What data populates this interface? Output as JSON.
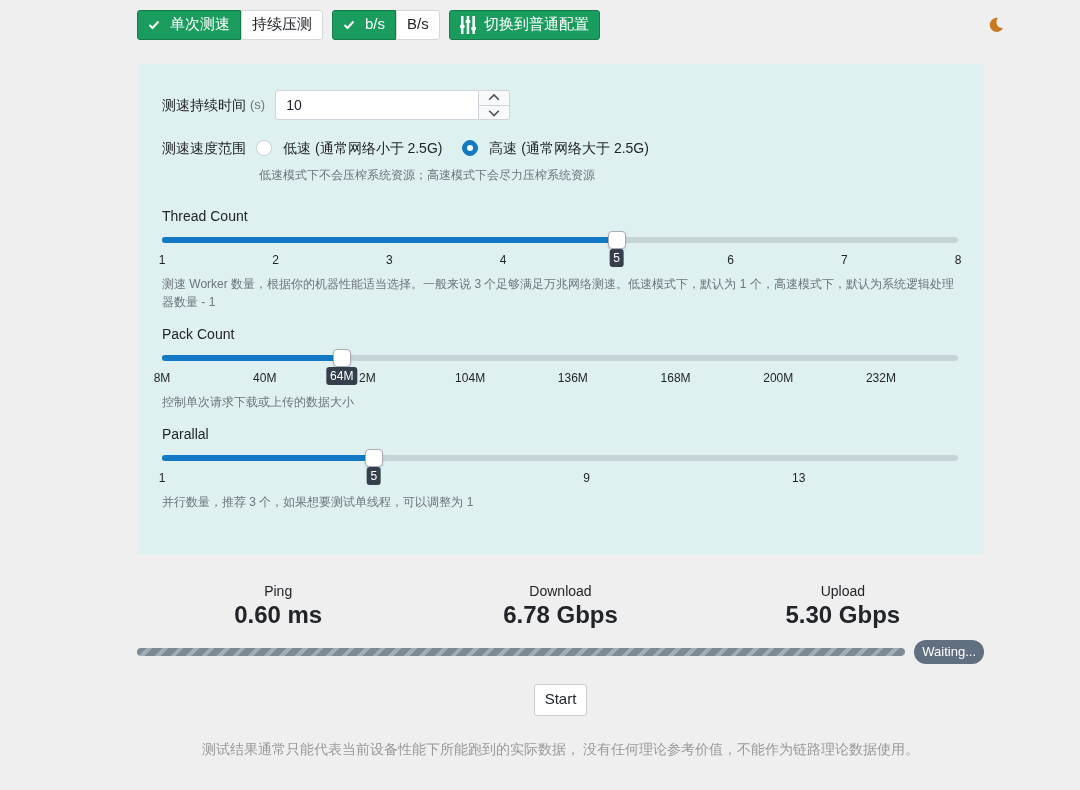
{
  "toolbar": {
    "mode_toggle": [
      {
        "label": "单次测速",
        "selected": true
      },
      {
        "label": "持续压测",
        "selected": false
      }
    ],
    "unit_toggle": [
      {
        "label": "b/s",
        "selected": true
      },
      {
        "label": "B/s",
        "selected": false
      }
    ],
    "switch_button": "切换到普通配置"
  },
  "settings": {
    "duration": {
      "label": "测速持续时间",
      "unit": "(s)",
      "value": "10"
    },
    "speed_range": {
      "label": "测速速度范围",
      "options": [
        {
          "label": "低速 (通常网络小于 2.5G)",
          "selected": false
        },
        {
          "label": "高速 (通常网络大于 2.5G)",
          "selected": true
        }
      ],
      "hint": "低速模式下不会压榨系统资源；高速模式下会尽力压榨系统资源"
    },
    "sliders": [
      {
        "label": "Thread Count",
        "level": 0.571,
        "value": "5",
        "ticks": [
          "1",
          "2",
          "3",
          "4",
          "6",
          "7",
          "8"
        ],
        "hint": "测速 Worker 数量，根据你的机器性能适当选择。一般来说 3 个足够满足万兆网络测速。低速模式下，默认为 1 个，高速模式下，默认为系统逻辑处理器数量 - 1"
      },
      {
        "label": "Pack Count",
        "level": 0.2258,
        "value": "64M",
        "ticks": [
          "8M",
          "40M",
          "2M",
          "104M",
          "136M",
          "168M",
          "200M",
          "232M"
        ],
        "hint": "控制单次请求下载或上传的数据大小"
      },
      {
        "label": "Parallal",
        "level": 0.266,
        "value": "5",
        "ticks": [
          "1",
          "9",
          "13"
        ],
        "hint": "并行数量，推荐 3 个，如果想要测试单线程，可以调整为 1"
      }
    ]
  },
  "results": [
    {
      "label": "Ping",
      "value": "0.60 ms"
    },
    {
      "label": "Download",
      "value": "6.78 Gbps"
    },
    {
      "label": "Upload",
      "value": "5.30 Gbps"
    }
  ],
  "progress": {
    "level": 1,
    "status": "Waiting..."
  },
  "start_button": "Start",
  "footer": "测试结果通常只能代表当前设备性能下所能跑到的实际数据， 没有任何理论参考价值，不能作为链路理论数据使用。"
}
